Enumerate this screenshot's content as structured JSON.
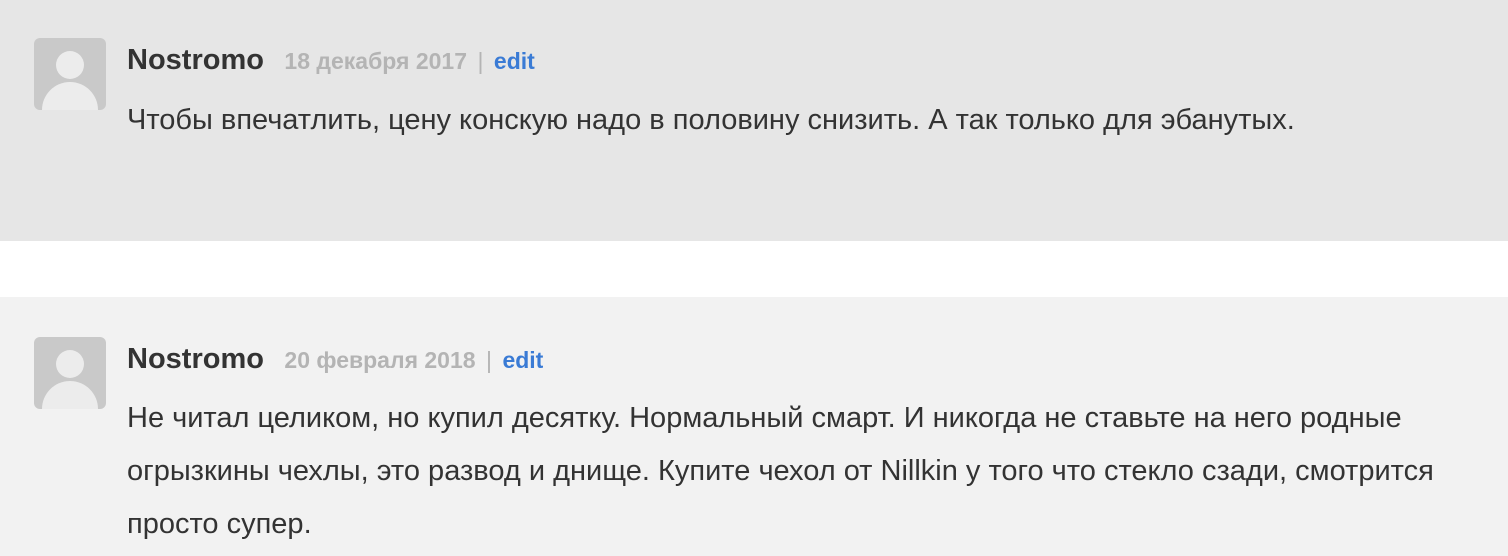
{
  "comments": [
    {
      "author": "Nostromo",
      "date": "18 декабря 2017",
      "separator": "|",
      "edit_label": "edit",
      "text": "Чтобы впечатлить, цену конскую надо в половину снизить. А так только для эбанутых."
    },
    {
      "author": "Nostromo",
      "date": "20 февраля 2018",
      "separator": "|",
      "edit_label": "edit",
      "text": "Не читал целиком, но купил десятку. Нормальный смарт. И никогда не ставьте на него родные огрызкины чехлы, это развод и днище. Купите чехол от Nillkin у того что стекло сзади, смотрится просто супер."
    }
  ],
  "colors": {
    "comment_bg_1": "#e6e6e6",
    "comment_bg_2": "#f2f2f2",
    "link": "#3a7bd5",
    "date": "#b4b4b4",
    "text": "#333333"
  },
  "icons": {
    "avatar": "default-user-avatar-icon"
  }
}
